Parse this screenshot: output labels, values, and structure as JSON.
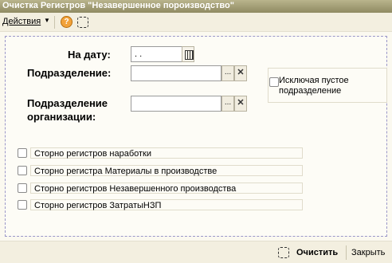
{
  "window": {
    "title": "Очистка Регистров \"Незавершенное пороизводство\""
  },
  "menubar": {
    "actions_label": "Действия",
    "actions_arrow": "▼",
    "help_label": "?"
  },
  "form": {
    "date_label": "На дату:",
    "date_value": " .  .",
    "division_label": "Подразделение:",
    "division_value": "",
    "org_division_label_line1": "Подразделение",
    "org_division_label_line2": "организации:",
    "org_division_value": "",
    "select_glyph": "...",
    "clear_glyph": "✕",
    "exclude_empty_label_line1": "Исключая пустое",
    "exclude_empty_label_line2": "подразделение",
    "exclude_empty_checked": false
  },
  "options": [
    {
      "label": "Сторно регистров наработки",
      "checked": false
    },
    {
      "label": "Сторно регистра Материалы в производстве",
      "checked": false
    },
    {
      "label": "Сторно регистров Незавершенного производства",
      "checked": false
    },
    {
      "label": "Сторно регистров ЗатратыНЗП",
      "checked": false
    }
  ],
  "footer": {
    "clear_label": "Очистить",
    "close_label": "Закрыть"
  }
}
